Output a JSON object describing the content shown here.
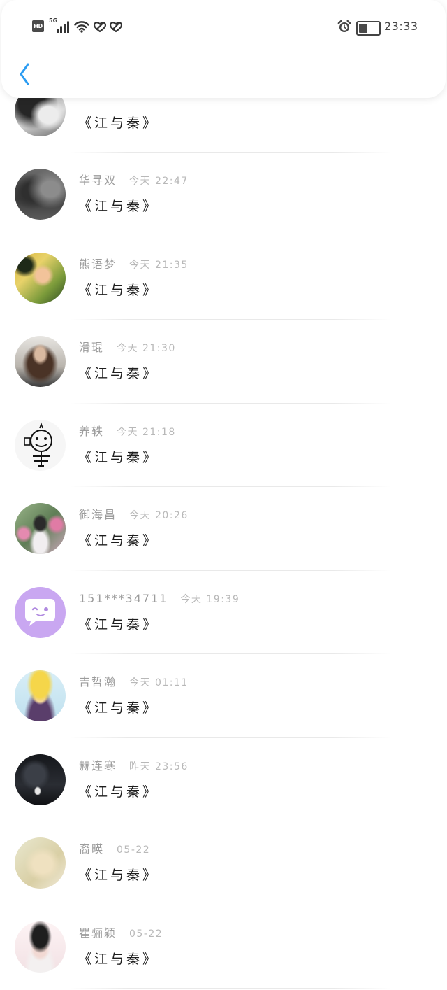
{
  "status_bar": {
    "hd": "HD",
    "network": "5G",
    "time": "23:33",
    "battery_percent": 45,
    "left_icons": [
      "hd-icon",
      "signal-icon",
      "wifi-icon",
      "heart-icon",
      "heart-icon"
    ],
    "right_icons": [
      "alarm-icon",
      "battery-icon"
    ]
  },
  "header": {
    "back_icon": "chevron-left-icon"
  },
  "colors": {
    "accent": "#2b9cf2",
    "name": "#9c9c9c",
    "time": "#b8b8b8",
    "title": "#1e1e1e"
  },
  "messages": [
    {
      "title": "《江与秦》"
    },
    {
      "name": "华寻双",
      "time": "今天 22:47",
      "title": "《江与秦》"
    },
    {
      "name": "熊语梦",
      "time": "今天 21:35",
      "title": "《江与秦》"
    },
    {
      "name": "滑琨",
      "time": "今天 21:30",
      "title": "《江与秦》"
    },
    {
      "name": "养轶",
      "time": "今天 21:18",
      "title": "《江与秦》"
    },
    {
      "name": "御海昌",
      "time": "今天 20:26",
      "title": "《江与秦》"
    },
    {
      "name": "151***34711",
      "time": "今天 19:39",
      "title": "《江与秦》"
    },
    {
      "name": "吉哲瀚",
      "time": "今天 01:11",
      "title": "《江与秦》"
    },
    {
      "name": "赫连寒",
      "time": "昨天 23:56",
      "title": "《江与秦》"
    },
    {
      "name": "裔暎",
      "time": "05-22",
      "title": "《江与秦》"
    },
    {
      "name": "瞿骊颖",
      "time": "05-22",
      "title": "《江与秦》"
    }
  ]
}
